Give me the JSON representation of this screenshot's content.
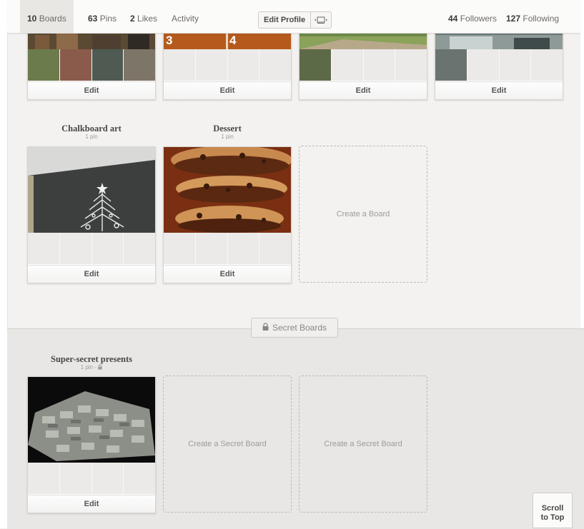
{
  "nav": {
    "boards_count": "10",
    "boards_label": "Boards",
    "pins_count": "63",
    "pins_label": "Pins",
    "likes_count": "2",
    "likes_label": "Likes",
    "activity_label": "Activity",
    "edit_profile_label": "Edit Profile",
    "followers_count": "44",
    "followers_label": "Followers",
    "following_count": "127",
    "following_label": "Following"
  },
  "top_boards": [
    {
      "edit": "Edit"
    },
    {
      "edit": "Edit",
      "cover_numbers": [
        "3",
        "4"
      ]
    },
    {
      "edit": "Edit"
    },
    {
      "edit": "Edit"
    }
  ],
  "boards": [
    {
      "title": "Chalkboard art",
      "subtitle": "1 pin",
      "edit": "Edit"
    },
    {
      "title": "Dessert",
      "subtitle": "1 pin",
      "edit": "Edit"
    }
  ],
  "create_board_label": "Create a Board",
  "secret": {
    "section_label": "Secret Boards",
    "board": {
      "title": "Super-secret presents",
      "subtitle": "1 pin ·",
      "edit": "Edit"
    },
    "create_labels": [
      "Create a Secret Board",
      "Create a Secret Board"
    ]
  },
  "scroll_top_label": [
    "Scroll",
    "to Top"
  ]
}
